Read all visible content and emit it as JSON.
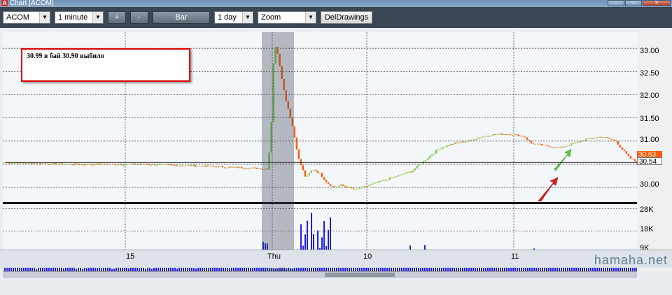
{
  "window": {
    "title": "Chart [ACOM]",
    "app_icon": "A"
  },
  "toolbar": {
    "symbol": "ACOM",
    "interval": "1 minute",
    "plus_label": "+",
    "minus_label": "-",
    "bar_label": "Bar",
    "range": "1 day",
    "zoom": "Zoom",
    "del_drawings_label": "DelDrawings"
  },
  "annotation": {
    "text": "30.99 в бай 30.90 выбило"
  },
  "price_axis": {
    "ticks": [
      "33.00",
      "32.50",
      "32.00",
      "31.50",
      "31.00",
      "30.00"
    ]
  },
  "price_tags": {
    "upper": "30.63",
    "lower": "30.54"
  },
  "volume_axis": {
    "ticks": [
      "28K",
      "18K",
      "9K"
    ]
  },
  "x_axis": {
    "ticks": [
      "15",
      "Thu",
      "10",
      "11"
    ]
  },
  "watermark": "hamaha.net",
  "colors": {
    "up": "#7ac943",
    "down": "#ff5a00",
    "volume": "#2020e0",
    "annotation_border": "#dd0000"
  },
  "chart_data": {
    "type": "candlestick",
    "symbol": "ACOM",
    "interval": "1 minute",
    "y_ticks": [
      30.0,
      30.5,
      31.0,
      31.5,
      32.0,
      32.5,
      33.0
    ],
    "price_path": [
      [
        0,
        30.54
      ],
      [
        10,
        30.52
      ],
      [
        20,
        30.5
      ],
      [
        30,
        30.5
      ],
      [
        40,
        30.5
      ],
      [
        50,
        30.48
      ],
      [
        60,
        30.45
      ],
      [
        70,
        30.42
      ],
      [
        75,
        30.4
      ],
      [
        76,
        31.0
      ],
      [
        77,
        33.1
      ],
      [
        78,
        32.9
      ],
      [
        80,
        32.0
      ],
      [
        82,
        31.4
      ],
      [
        84,
        30.6
      ],
      [
        86,
        30.2
      ],
      [
        88,
        30.4
      ],
      [
        90,
        30.3
      ],
      [
        92,
        30.1
      ],
      [
        94,
        30.0
      ],
      [
        96,
        30.05
      ],
      [
        98,
        30.0
      ],
      [
        100,
        29.95
      ],
      [
        104,
        30.05
      ],
      [
        108,
        30.15
      ],
      [
        112,
        30.25
      ],
      [
        116,
        30.35
      ],
      [
        120,
        30.6
      ],
      [
        124,
        30.85
      ],
      [
        128,
        30.95
      ],
      [
        132,
        31.0
      ],
      [
        136,
        31.1
      ],
      [
        140,
        31.15
      ],
      [
        144,
        31.15
      ],
      [
        148,
        31.1
      ],
      [
        150,
        30.95
      ],
      [
        154,
        30.9
      ],
      [
        158,
        30.85
      ],
      [
        162,
        30.95
      ],
      [
        166,
        31.05
      ],
      [
        170,
        31.1
      ],
      [
        174,
        31.0
      ],
      [
        176,
        30.8
      ],
      [
        178,
        30.63
      ],
      [
        180,
        30.54
      ]
    ],
    "volume_ticks": [
      "9K",
      "18K",
      "28K"
    ]
  }
}
